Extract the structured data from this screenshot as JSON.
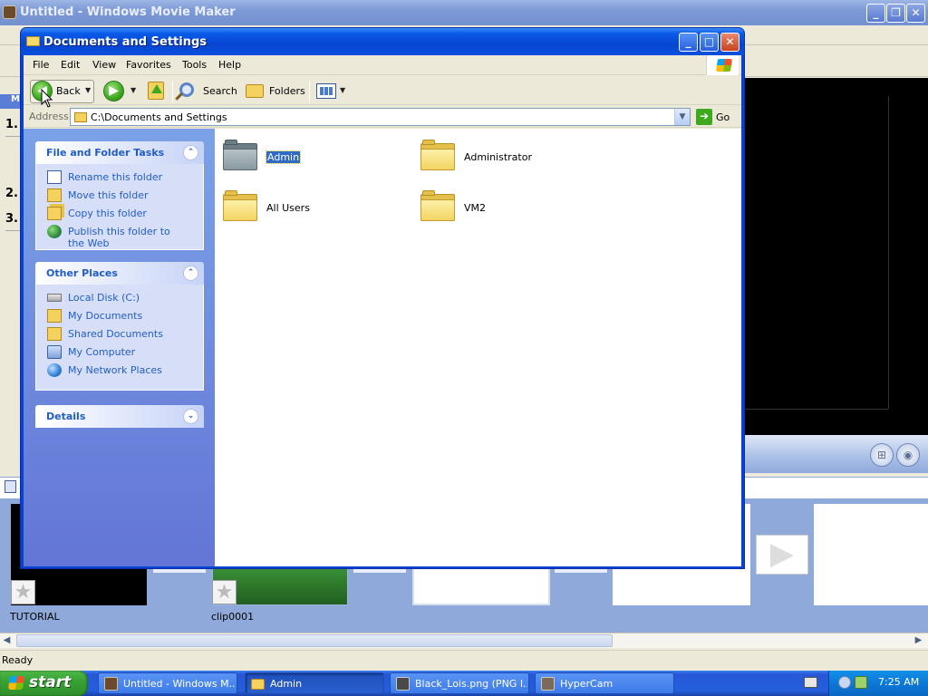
{
  "movie_maker": {
    "title": "Untitled - Windows Movie Maker",
    "controls": {
      "minimize": "_",
      "restore": "❐",
      "close": "✕"
    },
    "task_header": "M",
    "steps": [
      "1.",
      "2.",
      "3."
    ],
    "storyboard": {
      "clips": [
        {
          "label": "TUTORIAL"
        },
        {
          "label": "clip0001"
        }
      ]
    },
    "status": "Ready",
    "scroll_left": "◀",
    "scroll_right": "▶",
    "arrow": "▶"
  },
  "explorer": {
    "title": "Documents and Settings",
    "controls": {
      "minimize": "_",
      "maximize": "□",
      "close": "✕"
    },
    "menu": [
      "File",
      "Edit",
      "View",
      "Favorites",
      "Tools",
      "Help"
    ],
    "toolbar": {
      "back_label": "Back",
      "search_label": "Search",
      "folders_label": "Folders",
      "back_glyph": "◀",
      "forward_glyph": "▶",
      "drop_glyph": "▼"
    },
    "address": {
      "label": "Address",
      "value": "C:\\Documents and Settings",
      "go_label": "Go",
      "go_glyph": "➔",
      "drop_glyph": "▼"
    },
    "file_folder_tasks": {
      "title": "File and Folder Tasks",
      "toggle": "⌃",
      "items": [
        {
          "label": "Rename this folder",
          "icon": "rename-icon"
        },
        {
          "label": "Move this folder",
          "icon": "move-folder-icon"
        },
        {
          "label": "Copy this folder",
          "icon": "copy-folder-icon"
        },
        {
          "label": "Publish this folder to the Web",
          "icon": "globe-icon"
        }
      ]
    },
    "other_places": {
      "title": "Other Places",
      "toggle": "⌃",
      "items": [
        {
          "label": "Local Disk (C:)",
          "icon": "disk-icon"
        },
        {
          "label": "My Documents",
          "icon": "documents-icon"
        },
        {
          "label": "Shared Documents",
          "icon": "shared-folder-icon"
        },
        {
          "label": "My Computer",
          "icon": "computer-icon"
        },
        {
          "label": "My Network Places",
          "icon": "network-icon"
        }
      ]
    },
    "details": {
      "title": "Details",
      "toggle": "⌄"
    },
    "folders": [
      {
        "name": "Admin",
        "selected": true,
        "color": "gray"
      },
      {
        "name": "Administrator",
        "selected": false,
        "color": "yellow"
      },
      {
        "name": "All Users",
        "selected": false,
        "color": "yellow"
      },
      {
        "name": "VM2",
        "selected": false,
        "color": "yellow"
      }
    ]
  },
  "taskbar": {
    "start_label": "start",
    "buttons": [
      {
        "label": "Untitled - Windows M...",
        "active": false
      },
      {
        "label": "Admin",
        "active": true
      },
      {
        "label": "Black_Lois.png (PNG I...",
        "active": false
      },
      {
        "label": "HyperCam",
        "active": false
      }
    ],
    "clock": "7:25 AM"
  },
  "colors": {
    "xp_blue": "#0842d1",
    "task_link": "#215dc6",
    "selection": "#316ac5",
    "start_green": "#38a235"
  }
}
